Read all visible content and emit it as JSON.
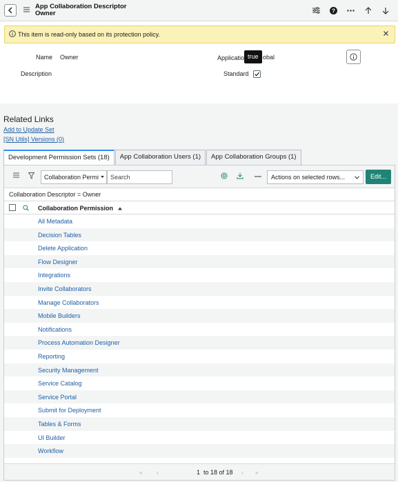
{
  "header": {
    "title_line1": "App Collaboration Descriptor",
    "title_line2": "Owner"
  },
  "banner": {
    "text": "This item is read-only based on its protection policy."
  },
  "form": {
    "name_label": "Name",
    "name_value": "Owner",
    "application_label": "Applicatio",
    "application_value": "obal",
    "tooltip_text": "true",
    "description_label": "Description",
    "standard_label": "Standard",
    "standard_checked": true
  },
  "related": {
    "title": "Related Links",
    "links": [
      "Add to Update Set",
      "[SN Utils] Versions (0)"
    ]
  },
  "tabs": [
    "Development Permission Sets (18)",
    "App Collaboration Users (1)",
    "App Collaboration Groups (1)"
  ],
  "toolbar": {
    "filter_field": "Collaboration Permi",
    "search_placeholder": "Search",
    "actions_label": "Actions on selected rows...",
    "edit_label": "Edit..."
  },
  "breadcrumb": "Collaboration Descriptor = Owner",
  "table": {
    "column_header": "Collaboration Permission",
    "rows": [
      "All Metadata",
      "Decision Tables",
      "Delete Application",
      "Flow Designer",
      "Integrations",
      "Invite Collaborators",
      "Manage Collaborators",
      "Mobile Builders",
      "Notifications",
      "Process Automation Designer",
      "Reporting",
      "Security Management",
      "Service Catalog",
      "Service Portal",
      "Submit for Deployment",
      "Tables & Forms",
      "UI Builder",
      "Workflow"
    ]
  },
  "pagination": {
    "current": "1",
    "range": "to 18 of 18"
  },
  "colors": {
    "accent": "#1f8476",
    "link": "#1f5fa5",
    "banner": "#fbf2b9",
    "tab_active": "#278efc"
  }
}
